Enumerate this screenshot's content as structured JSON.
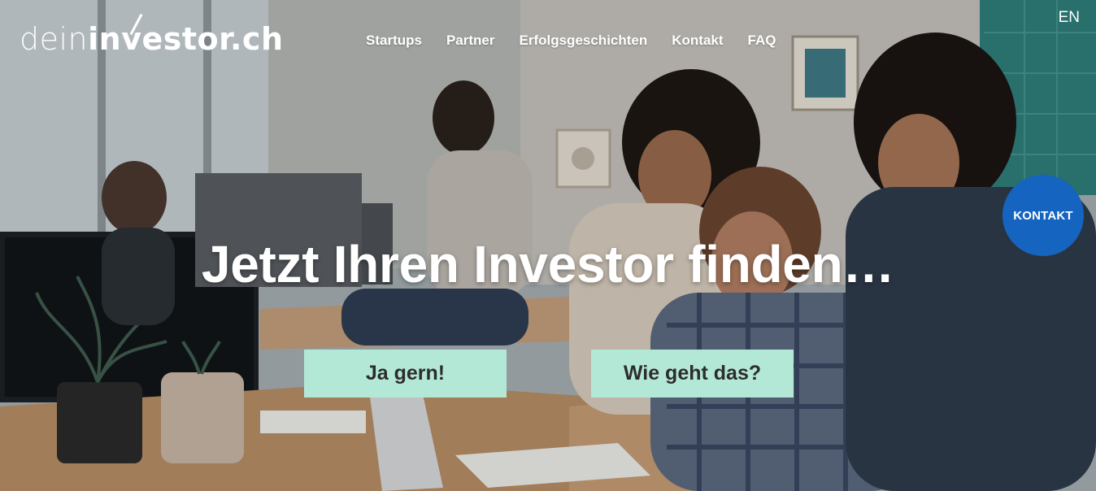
{
  "header": {
    "logo": {
      "light": "dein",
      "bold": "investor.ch"
    },
    "nav": [
      "Startups",
      "Partner",
      "Erfolgsgeschichten",
      "Kontakt",
      "FAQ"
    ],
    "language": "EN"
  },
  "hero": {
    "headline": "Jetzt Ihren Investor finden…",
    "buttons": {
      "primary": "Ja gern!",
      "secondary": "Wie geht das?"
    }
  },
  "floating": {
    "contact_label": "KONTAKT"
  },
  "colors": {
    "cta_bg": "#b4e8d6",
    "fab_bg": "#1565c0",
    "text_light": "#ffffff"
  }
}
